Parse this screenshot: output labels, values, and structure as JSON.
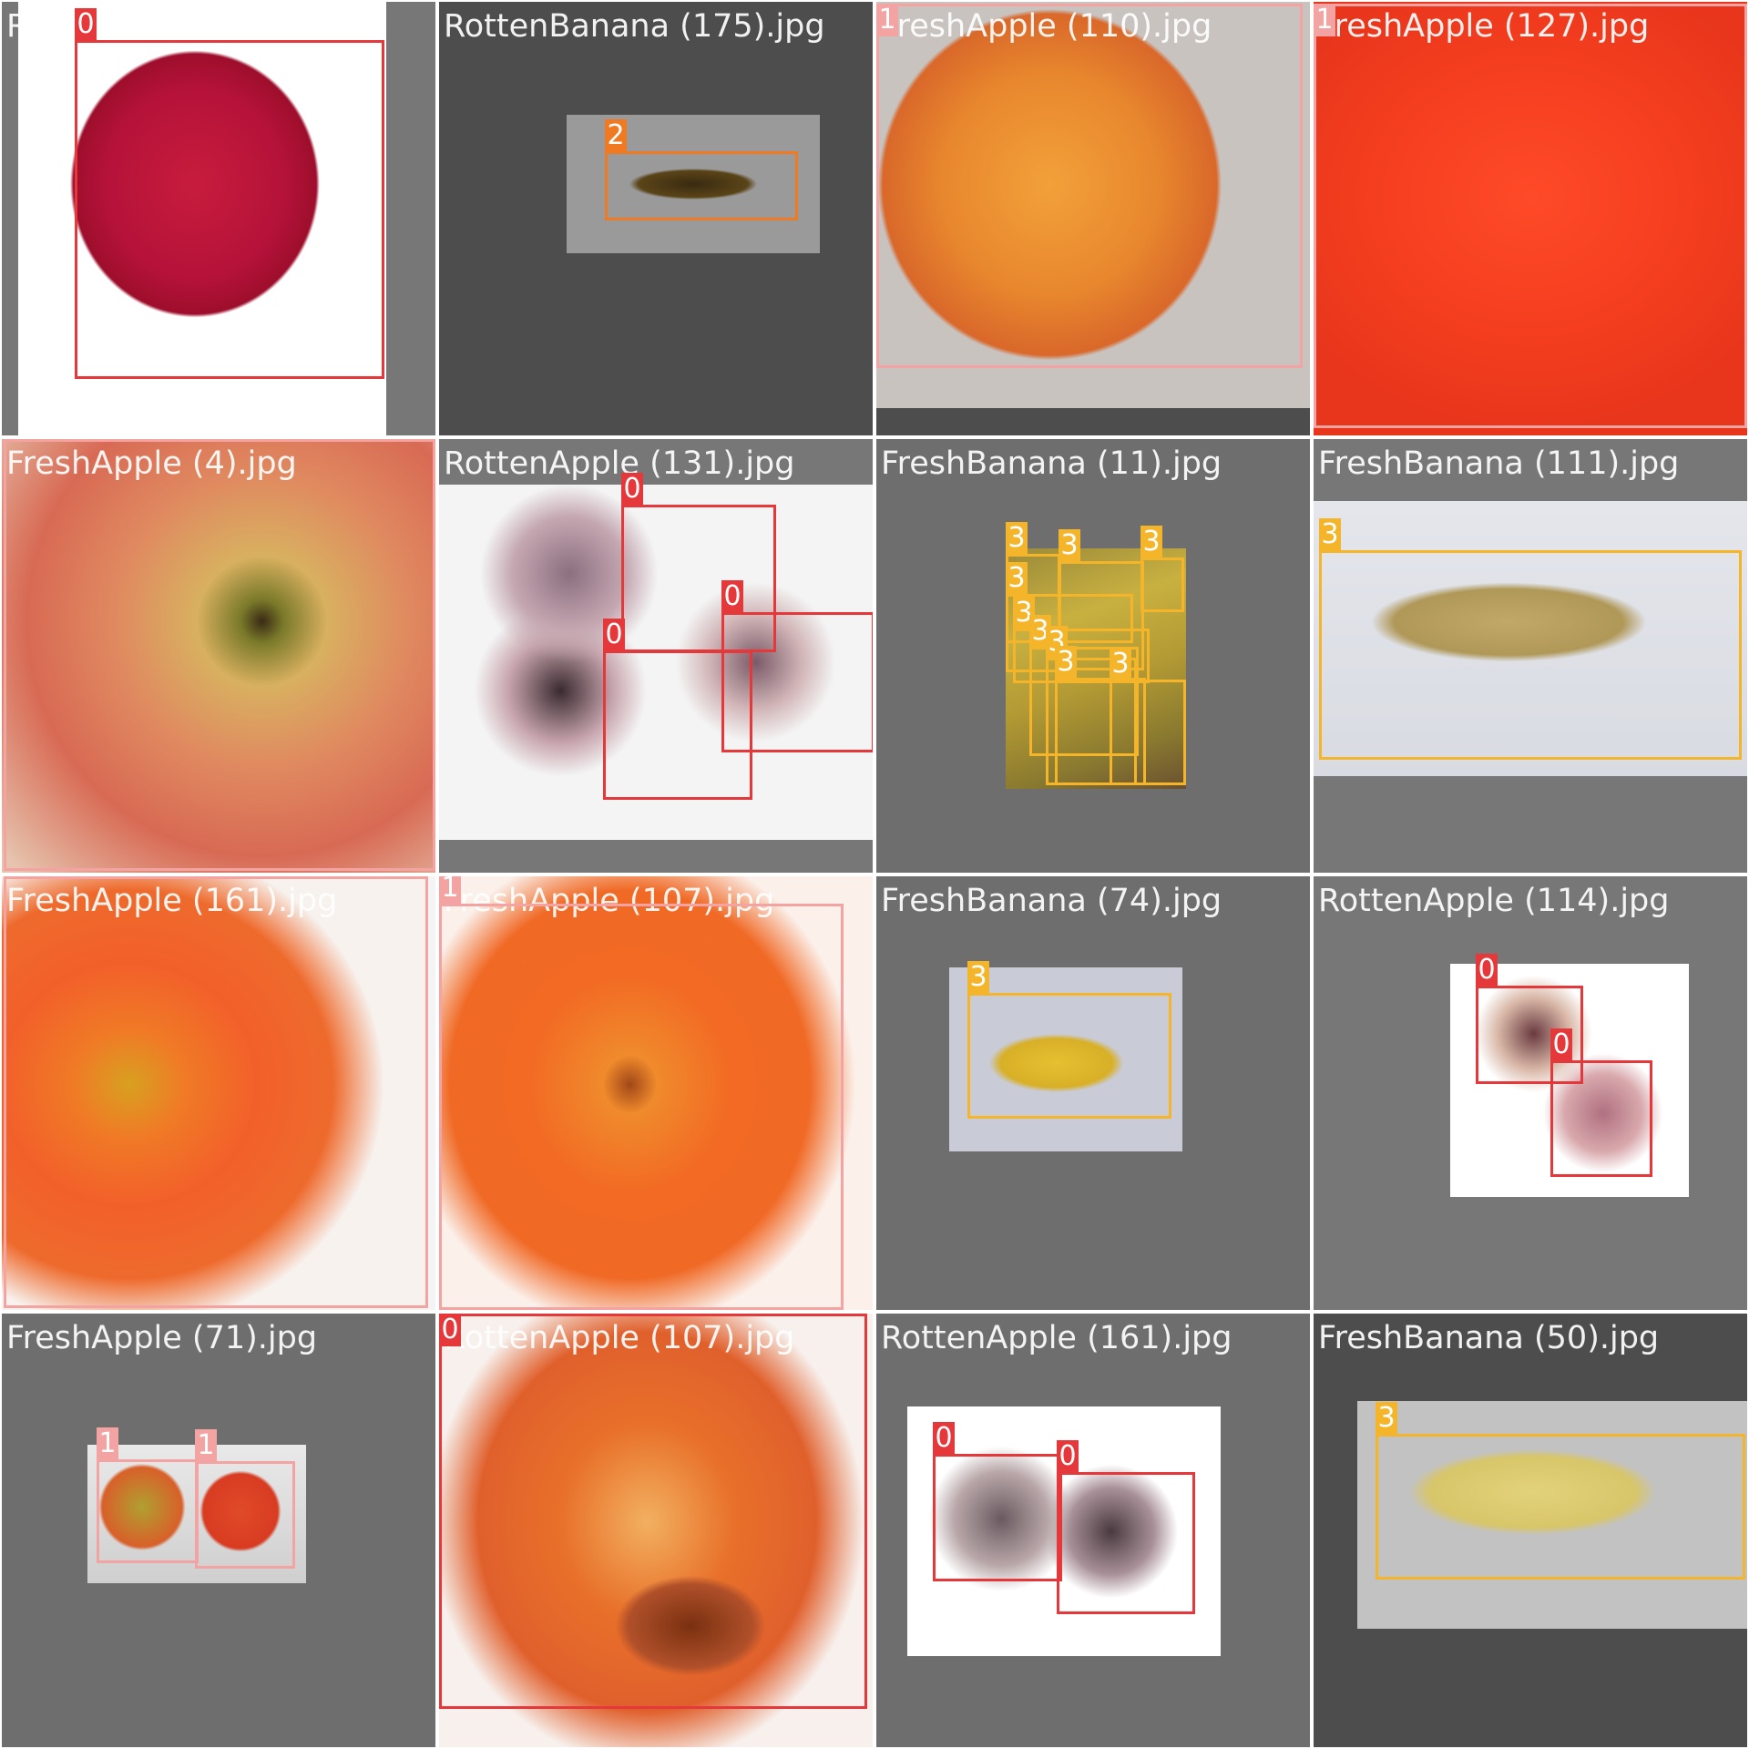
{
  "mosaic": {
    "label_colors": {
      "0": "#e5383b",
      "1": "#f4a3a3",
      "2": "#f07a22",
      "3": "#f5b52b"
    },
    "tiles": [
      {
        "filename": "RottenApple (72).jpg",
        "photo": "red apple with bruise",
        "labels": [
          "0"
        ]
      },
      {
        "filename": "RottenBanana (175).jpg",
        "photo": "small dark rotten banana",
        "labels": [
          "2"
        ]
      },
      {
        "filename": "FreshApple (110).jpg",
        "photo": "yellow-orange apple with stem",
        "labels": [
          "1"
        ]
      },
      {
        "filename": "FreshApple (127).jpg",
        "photo": "close-up red apple",
        "labels": [
          "1"
        ]
      },
      {
        "filename": "FreshApple (4).jpg",
        "photo": "top view of streaked apple",
        "labels": [
          "1"
        ]
      },
      {
        "filename": "RottenApple (131).jpg",
        "photo": "three rotten apples",
        "labels": [
          "0",
          "0",
          "0"
        ]
      },
      {
        "filename": "FreshBanana (11).jpg",
        "photo": "bunch of bananas",
        "labels": [
          "3",
          "3",
          "3",
          "3",
          "3",
          "3",
          "3",
          "3",
          "3"
        ]
      },
      {
        "filename": "FreshBanana (111).jpg",
        "photo": "single speckled banana",
        "labels": [
          "3"
        ]
      },
      {
        "filename": "FreshApple (161).jpg",
        "photo": "close-up orange-red apple",
        "labels": [
          "1"
        ]
      },
      {
        "filename": "FreshApple (107).jpg",
        "photo": "top view of orange apple with stem",
        "labels": [
          "1"
        ]
      },
      {
        "filename": "FreshBanana (74).jpg",
        "photo": "yellow banana",
        "labels": [
          "3"
        ]
      },
      {
        "filename": "RottenApple (114).jpg",
        "photo": "two rotten apples",
        "labels": [
          "0",
          "0"
        ]
      },
      {
        "filename": "FreshApple (71).jpg",
        "photo": "two small apples",
        "labels": [
          "1",
          "1"
        ]
      },
      {
        "filename": "RottenApple (107).jpg",
        "photo": "apple with rotten patch",
        "labels": [
          "0"
        ]
      },
      {
        "filename": "RottenApple (161).jpg",
        "photo": "two pale rotten apples",
        "labels": [
          "0",
          "0"
        ]
      },
      {
        "filename": "FreshBanana (50).jpg",
        "photo": "single yellow banana",
        "labels": [
          "3"
        ]
      }
    ]
  }
}
